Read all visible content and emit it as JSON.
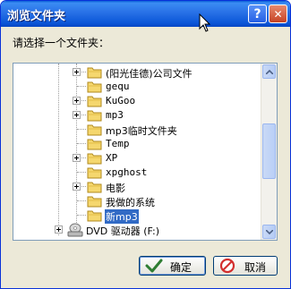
{
  "window": {
    "title": "浏览文件夹",
    "help_glyph": "?",
    "close_glyph": "✕"
  },
  "prompt": "请选择一个文件夹：",
  "tree": {
    "items": [
      {
        "label": "(阳光佳德)公司文件",
        "has_children": true
      },
      {
        "label": "gequ",
        "has_children": false
      },
      {
        "label": "KuGoo",
        "has_children": true
      },
      {
        "label": "mp3",
        "has_children": true
      },
      {
        "label": "mp3临时文件夹",
        "has_children": false
      },
      {
        "label": "Temp",
        "has_children": false
      },
      {
        "label": "XP",
        "has_children": true
      },
      {
        "label": "xpghost",
        "has_children": false
      },
      {
        "label": "电影",
        "has_children": true
      },
      {
        "label": "我做的系统",
        "has_children": false
      },
      {
        "label": "新mp3",
        "has_children": false,
        "selected": true
      }
    ],
    "drive": {
      "label": "DVD 驱动器 (F:)",
      "icon": "dvd-drive-icon"
    }
  },
  "buttons": {
    "ok_label": "确定",
    "cancel_label": "取消"
  },
  "colors": {
    "titlebar": "#0b56d8",
    "selection": "#316ac5",
    "folder": "#f5d76e"
  }
}
